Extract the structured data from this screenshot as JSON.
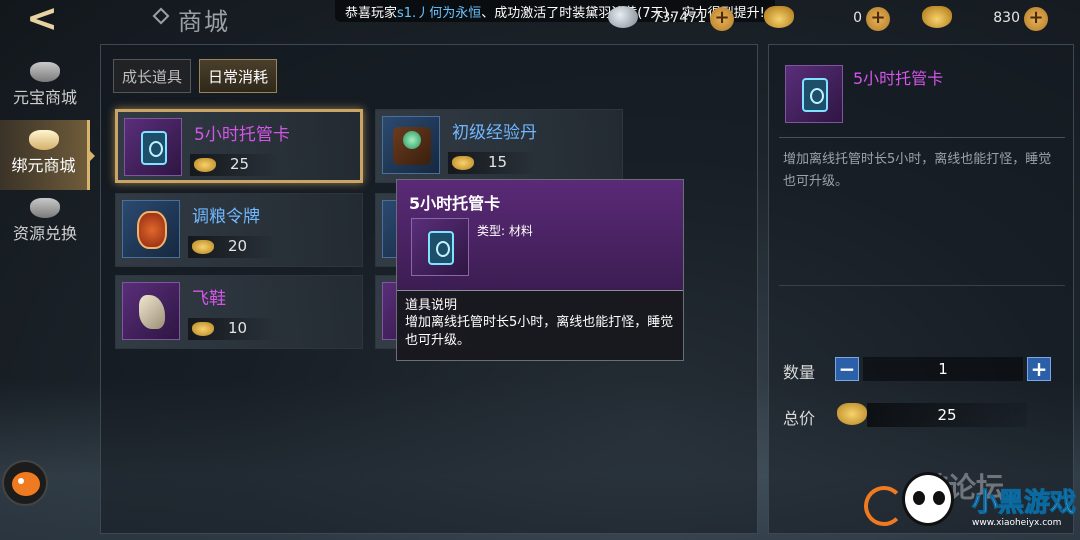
{
  "header": {
    "back_icon": "back-arrow-icon",
    "title": "商城",
    "broadcast": {
      "prefix": "恭喜玩家",
      "server": "s1.",
      "player": "丿何为永恒",
      "suffix": "、成功激活了时装黛羽流黄(7天)，实力得到提升!"
    },
    "currencies": [
      {
        "icon": "silver-icon",
        "value": "737471"
      },
      {
        "icon": "gold-ingot-icon",
        "value": "0"
      },
      {
        "icon": "bound-ingot-icon",
        "value": "830"
      }
    ],
    "add_label": "+"
  },
  "sidebar": {
    "items": [
      {
        "label": "元宝商城",
        "icon": "ingot-icon",
        "active": false
      },
      {
        "label": "绑元商城",
        "icon": "bound-ingot-icon",
        "active": true
      },
      {
        "label": "资源兑换",
        "icon": "exchange-icon",
        "active": false
      }
    ]
  },
  "tabs": [
    {
      "label": "成长道具",
      "active": false
    },
    {
      "label": "日常消耗",
      "active": true
    }
  ],
  "items": [
    {
      "name": "5小时托管卡",
      "price": "25",
      "quality": "purple",
      "icon": "card-icon",
      "selected": true
    },
    {
      "name": "初级经验丹",
      "price": "15",
      "quality": "blue",
      "icon": "exp-pill-icon",
      "selected": false
    },
    {
      "name": "调粮令牌",
      "price": "20",
      "quality": "blue",
      "icon": "token-icon",
      "selected": false
    },
    {
      "name": "飞鞋",
      "price": "10",
      "quality": "purple",
      "icon": "flying-boots-icon",
      "selected": false
    }
  ],
  "tooltip": {
    "name": "5小时托管卡",
    "type_label": "类型: 材料",
    "desc_label": "道具说明",
    "desc": "增加离线托管时长5小时，离线也能打怪，睡觉也可升级。"
  },
  "detail": {
    "name": "5小时托管卡",
    "desc": "增加离线托管时长5小时，离线也能打怪，睡觉也可升级。",
    "quantity_label": "数量",
    "quantity": "1",
    "minus_label": "−",
    "plus_label": "+",
    "total_label": "总价",
    "total": "25"
  },
  "watermark": {
    "main": "小黑游戏",
    "back": "游论坛",
    "sub": "www.xiaoheiyx.com"
  },
  "colors": {
    "purple_quality": "#d455e8",
    "blue_quality": "#6fb8ff",
    "gold_accent": "#caa565"
  }
}
